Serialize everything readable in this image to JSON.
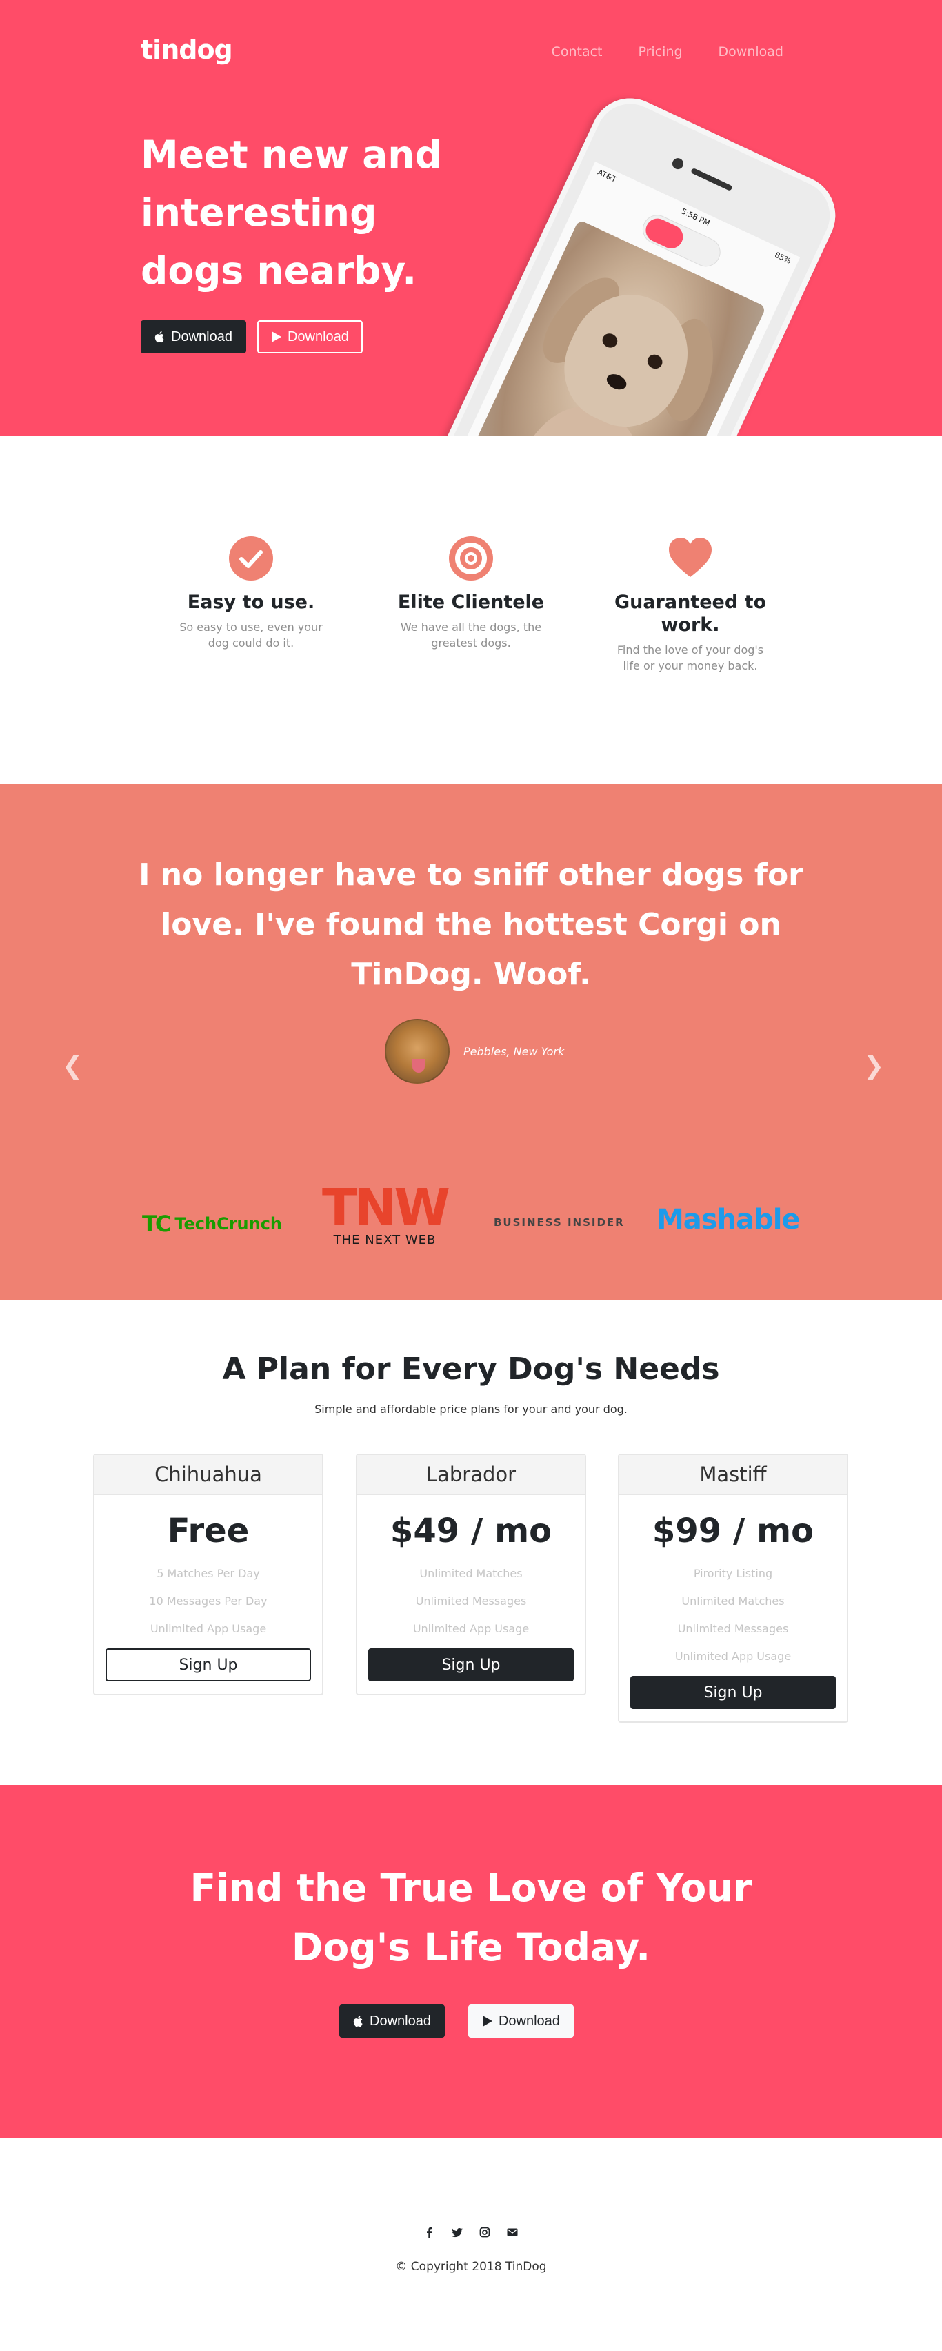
{
  "brand": "tindog",
  "nav": {
    "links": [
      "Contact",
      "Pricing",
      "Download"
    ]
  },
  "hero": {
    "title": "Meet new and interesting dogs nearby.",
    "download_apple": "Download",
    "download_google": "Download",
    "phone": {
      "carrier": "AT&T",
      "time": "5:58 PM",
      "battery": "85%"
    }
  },
  "features": [
    {
      "icon": "check-circle-icon",
      "title": "Easy to use.",
      "text": "So easy to use, even your dog could do it."
    },
    {
      "icon": "bullseye-icon",
      "title": "Elite Clientele",
      "text": "We have all the dogs, the greatest dogs."
    },
    {
      "icon": "heart-icon",
      "title": "Guaranteed to work.",
      "text": "Find the love of your dog's life or your money back."
    }
  ],
  "testimonial": {
    "quote": "I no longer have to sniff other dogs for love. I've found the hottest Corgi on TinDog. Woof.",
    "author": "Pebbles, New York"
  },
  "press": {
    "techcrunch": "TechCrunch",
    "tnw_mark": "TNW",
    "tnw_sub": "THE NEXT WEB",
    "business_insider": "BUSINESS INSIDER",
    "mashable": "Mashable"
  },
  "pricing": {
    "title": "A Plan for Every Dog's Needs",
    "subtitle": "Simple and affordable price plans for your and your dog.",
    "plans": [
      {
        "name": "Chihuahua",
        "price": "Free",
        "features": [
          "5 Matches Per Day",
          "10 Messages Per Day",
          "Unlimited App Usage"
        ],
        "button": "Sign Up"
      },
      {
        "name": "Labrador",
        "price": "$49 / mo",
        "features": [
          "Unlimited Matches",
          "Unlimited Messages",
          "Unlimited App Usage"
        ],
        "button": "Sign Up"
      },
      {
        "name": "Mastiff",
        "price": "$99 / mo",
        "features": [
          "Pirority Listing",
          "Unlimited Matches",
          "Unlimited Messages",
          "Unlimited App Usage"
        ],
        "button": "Sign Up"
      }
    ]
  },
  "cta": {
    "title": "Find the True Love of Your Dog's Life Today.",
    "download_apple": "Download",
    "download_google": "Download"
  },
  "footer": {
    "social_icons": [
      "facebook-icon",
      "twitter-icon",
      "instagram-icon",
      "envelope-icon"
    ],
    "copyright": "© Copyright 2018 TinDog"
  },
  "colors": {
    "primary": "#ff4c68",
    "testimonial_bg": "#ef8172",
    "dark": "#212529",
    "muted": "#8f8f8f"
  }
}
